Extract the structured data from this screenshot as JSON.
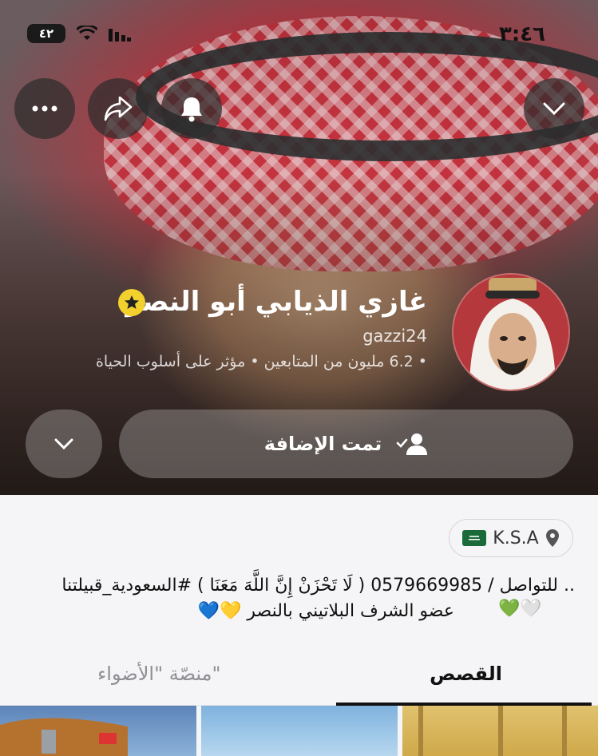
{
  "status_bar": {
    "time": "٣:٤٦",
    "battery": "٤٢"
  },
  "top_actions": {
    "more_icon": "ellipsis-icon",
    "share_icon": "share-icon",
    "notify_icon": "bell-icon",
    "collapse_icon": "chevron-down-icon"
  },
  "profile": {
    "display_name": "غازي الذيابي أبو النصر",
    "username": "gazzi24",
    "meta": "• 6.2 مليون من المتابعين • مؤثر على أسلوب الحياة",
    "badge_icon": "star-badge-icon"
  },
  "actions": {
    "added_label": "تمت الإضافة",
    "added_icon": "person-check-icon",
    "more_options_icon": "chevron-down-icon"
  },
  "location": {
    "label": "K.S.A",
    "icon": "location-pin-icon",
    "flag": "saudi-flag"
  },
  "bio": {
    "line1": ".. للتواصل / 0579669985 ( لَا تَحْزَنْ إِنَّ اللَّهَ مَعَنَا ) #السعودية_قبيلتنا",
    "line2": "عضو الشرف البلاتيني بالنصر 💛💙",
    "line2_hearts": "💚🤍"
  },
  "tabs": {
    "stories": "القصص",
    "spotlight": "منصّة \"الأضواء\""
  },
  "colors": {
    "accent_star": "#f2d12e",
    "active_tab": "#111111",
    "inactive_tab": "#8e8e93"
  }
}
